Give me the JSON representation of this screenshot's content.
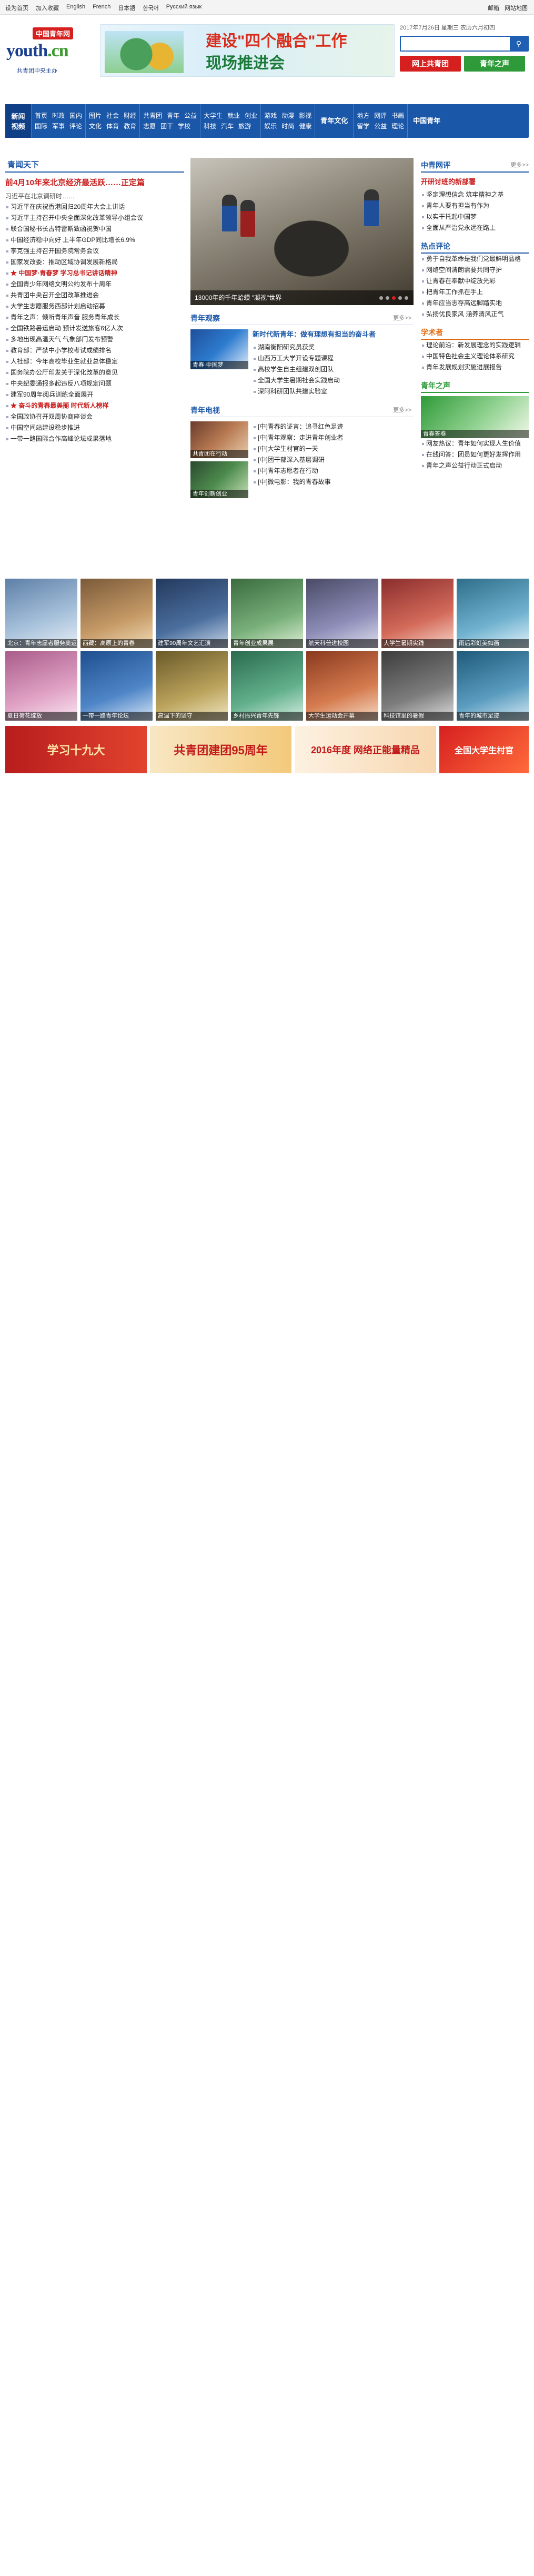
{
  "topbar": {
    "links": [
      "设为首页",
      "加入收藏",
      "English",
      "French",
      "日本語",
      "한국어",
      "Русский язык"
    ],
    "right": [
      "邮箱",
      "网站地图"
    ]
  },
  "header": {
    "logo_cn": "中国青年网",
    "logo_en_a": "youth",
    "logo_en_b": ".cn",
    "logo_slogan": "共青团中央主办",
    "banner_line1": "建设\"四个融合\"工作",
    "banner_line2": "现场推进会",
    "date": "2017年7月26日 星期三 农历六月初四",
    "search_placeholder": "",
    "btn_red": "网上共青团",
    "btn_green": "青年之声"
  },
  "nav": {
    "main1": "新闻",
    "main2": "视频",
    "cols": [
      {
        "rows": [
          [
            "首页",
            "时政",
            "国内"
          ],
          [
            "国际",
            "军事",
            "评论"
          ]
        ]
      },
      {
        "rows": [
          [
            "图片",
            "社会",
            "财经"
          ],
          [
            "文化",
            "体育",
            "教育"
          ]
        ]
      },
      {
        "rows": [
          [
            "共青团",
            "青年",
            "公益"
          ],
          [
            "志愿",
            "团干",
            "学校"
          ]
        ]
      },
      {
        "rows": [
          [
            "大学生",
            "就业",
            "创业"
          ],
          [
            "科技",
            "汽车",
            "旅游"
          ]
        ]
      },
      {
        "rows": [
          [
            "游戏",
            "动漫",
            "影视"
          ],
          [
            "娱乐",
            "时尚",
            "健康"
          ]
        ]
      },
      {
        "rows": [
          [
            "地方",
            "网评",
            "书画"
          ],
          [
            "留学",
            "公益",
            "理论"
          ]
        ]
      }
    ],
    "big1": "青年文化",
    "big2": "中国青年"
  },
  "left": {
    "hd": "青闻天下",
    "headline": "前4月10年来北京经济最活跃……正定篇",
    "summary": "习近平在北京调研时……",
    "items": [
      {
        "text": "习近平在庆祝香港回归20周年大会上讲话",
        "red": false
      },
      {
        "text": "习近平主持召开中央全面深化改革领导小组会议",
        "red": false
      },
      {
        "text": "联合国秘书长古特雷斯致函祝贺中国",
        "red": false
      },
      {
        "text": "中国经济稳中向好 上半年GDP同比增长6.9%",
        "red": false
      },
      {
        "text": "李克强主持召开国务院常务会议",
        "red": false
      },
      {
        "text": "国家发改委：推动区域协调发展新格局",
        "red": false
      },
      {
        "text": "★ 中国梦·青春梦 学习总书记讲话精神",
        "red": true
      },
      {
        "text": "全国青少年网络文明公约发布十周年",
        "red": false
      },
      {
        "text": "共青团中央召开全团改革推进会",
        "red": false
      },
      {
        "text": "大学生志愿服务西部计划启动招募",
        "red": false
      },
      {
        "text": "青年之声：倾听青年声音 服务青年成长",
        "red": false
      },
      {
        "text": "全国铁路暑运启动 预计发送旅客6亿人次",
        "red": false
      },
      {
        "text": "多地出现高温天气 气象部门发布预警",
        "red": false
      },
      {
        "text": "教育部：严禁中小学校考试成绩排名",
        "red": false
      },
      {
        "text": "人社部：今年高校毕业生就业总体稳定",
        "red": false
      },
      {
        "text": "国务院办公厅印发关于深化改革的意见",
        "red": false
      },
      {
        "text": "中央纪委通报多起违反八项规定问题",
        "red": false
      },
      {
        "text": "建军90周年阅兵训练全面展开",
        "red": false
      },
      {
        "text": "★ 奋斗的青春最美丽 时代新人榜样",
        "red": true
      },
      {
        "text": "全国政协召开双周协商座谈会",
        "red": false
      },
      {
        "text": "中国空间站建设稳步推进",
        "red": false
      },
      {
        "text": "一带一路国际合作高峰论坛成果落地",
        "red": false
      }
    ]
  },
  "mid": {
    "slide_caption": "13000年的千年蛤蟆 \"凝视\"世界",
    "sub1": "青年观察",
    "sub1_more": "更多>>",
    "obs_title": "新时代新青年：做有理想有担当的奋斗者",
    "obs_items": [
      "湖南衡阳研究员获奖",
      "山西万工大学开设专题课程",
      "高校学生自主组建双创团队",
      "全国大学生暑期社会实践启动",
      "深阿科研团队共建实验室"
    ],
    "sub2": "青年电视",
    "sub2_more": "更多>>",
    "tv_items": [
      "[中]青春的证言：追寻红色足迹",
      "[中]青年观察：走进青年创业者",
      "[中]大学生村官的一天",
      "[中]团干部深入基层调研",
      "[中]青年志愿者在行动",
      "[中]微电影：我的青春故事"
    ],
    "thumbs": [
      "青春·中国梦",
      "共青团在行动",
      "青年创新创业"
    ]
  },
  "right": {
    "hd1": "中青网评",
    "hd1_more": "更多>>",
    "ping_headline": "开研讨班的新部署",
    "ping_items": [
      "坚定理想信念 筑牢精神之基",
      "青年人要有担当有作为",
      "以实干托起中国梦",
      "全面从严治党永远在路上"
    ],
    "hd2": "热点评论",
    "hot_items": [
      "勇于自我革命是我们党最鲜明品格",
      "网络空间清朗需要共同守护",
      "让青春在奉献中绽放光彩",
      "把青年工作抓在手上",
      "青年应当志存高远脚踏实地",
      "弘扬优良家风 涵养清风正气"
    ],
    "hd3": "学术者",
    "scholar_items": [
      "理论前沿：新发展理念的实践逻辑",
      "中国特色社会主义理论体系研究",
      "青年发展规划实施进展报告"
    ],
    "hd4": "青年之声",
    "voice_img_title": "青春答卷",
    "voice_items": [
      "网友热议：青年如何实现人生价值",
      "在线问答：团员如何更好发挥作用",
      "青年之声公益行动正式启动"
    ]
  },
  "strip": {
    "items": [
      "北京：青年志愿者服务奥运场馆",
      "西藏：高原上的青春",
      "建军90周年文艺汇演",
      "青年创业成果展",
      "航天科普进校园",
      "大学生暑期实践",
      "雨后彩虹美如画",
      "夏日荷花绽放",
      "一带一路青年论坛",
      "高温下的坚守",
      "乡村振兴青年先锋",
      "大学生运动会开幕",
      "科技馆里的暑假",
      "青年的城市足迹"
    ]
  },
  "promo": [
    "学习十九大",
    "共青团建团95周年",
    "2016年度 网络正能量精品",
    "全国大学生村官"
  ]
}
